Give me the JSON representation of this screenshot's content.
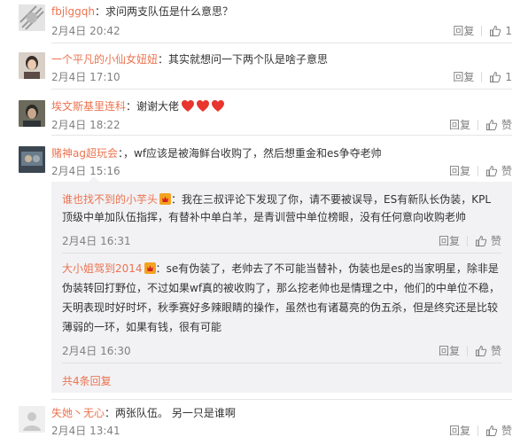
{
  "comments": [
    {
      "username": "fbjlggqh",
      "separator": "：",
      "text": "求问两支队伍是什么意思？",
      "time": "2月4日 20:42",
      "reply_label": "回复",
      "like_count": "1"
    },
    {
      "username": "一个平凡的小仙女妞妞",
      "separator": "：",
      "text": "其实就想问一下两个队是啥子意思",
      "time": "2月4日 17:10",
      "reply_label": "回复",
      "like_count": "1"
    },
    {
      "username": "埃文斯基里连科",
      "separator": "：",
      "text": "谢谢大佬",
      "time": "2月4日 18:22",
      "reply_label": "回复",
      "like_label": "赞"
    },
    {
      "username": "赌神ag超玩会",
      "separator": "：",
      "text": "，wf应该是被海鲜台收购了，然后想重金和es争夺老帅",
      "time": "2月4日 15:16",
      "reply_label": "回复",
      "like_label": "赞"
    },
    {
      "username": "失她丶无心",
      "separator": "：",
      "text": "两张队伍。 另一只是谁啊",
      "time": "2月4日 13:41",
      "reply_label": "回复",
      "like_label": "赞"
    }
  ],
  "replies": [
    {
      "username": "谁也找不到的小芋头",
      "separator": "：",
      "line1": "我在三叔评论下发现了你，请不要被误导，ES有新队长伪装，KPL",
      "line2": "顶级中单加队伍指挥，有替补中单白羊，是青训营中单位榜眼，没有任何意向收购老帅",
      "time": "2月4日 16:31",
      "reply_label": "回复",
      "like_label": "赞"
    },
    {
      "username": "大小姐驾到2014",
      "separator": "：",
      "line1": "se有伪装了，老帅去了不可能当替补，伪装也是es的当家明星，除非是",
      "line2": "伪装转回打野位，不过如果wf真的被收购了，那么挖老帅也是情理之中，他们的中单位不稳，",
      "line3": "天明表现时好时坏，秋季赛好多辣眼睛的操作，虽然也有诸葛亮的伪五杀，但是终究还是比较",
      "line4": "薄弱的一环，如果有钱，很有可能",
      "time": "2月4日 16:30",
      "reply_label": "回复",
      "like_label": "赞"
    }
  ],
  "more_replies": "共4条回复",
  "colors": {
    "name": "#eb7350",
    "reply_bg": "#f2f2f5",
    "heart": "#e8352e"
  }
}
